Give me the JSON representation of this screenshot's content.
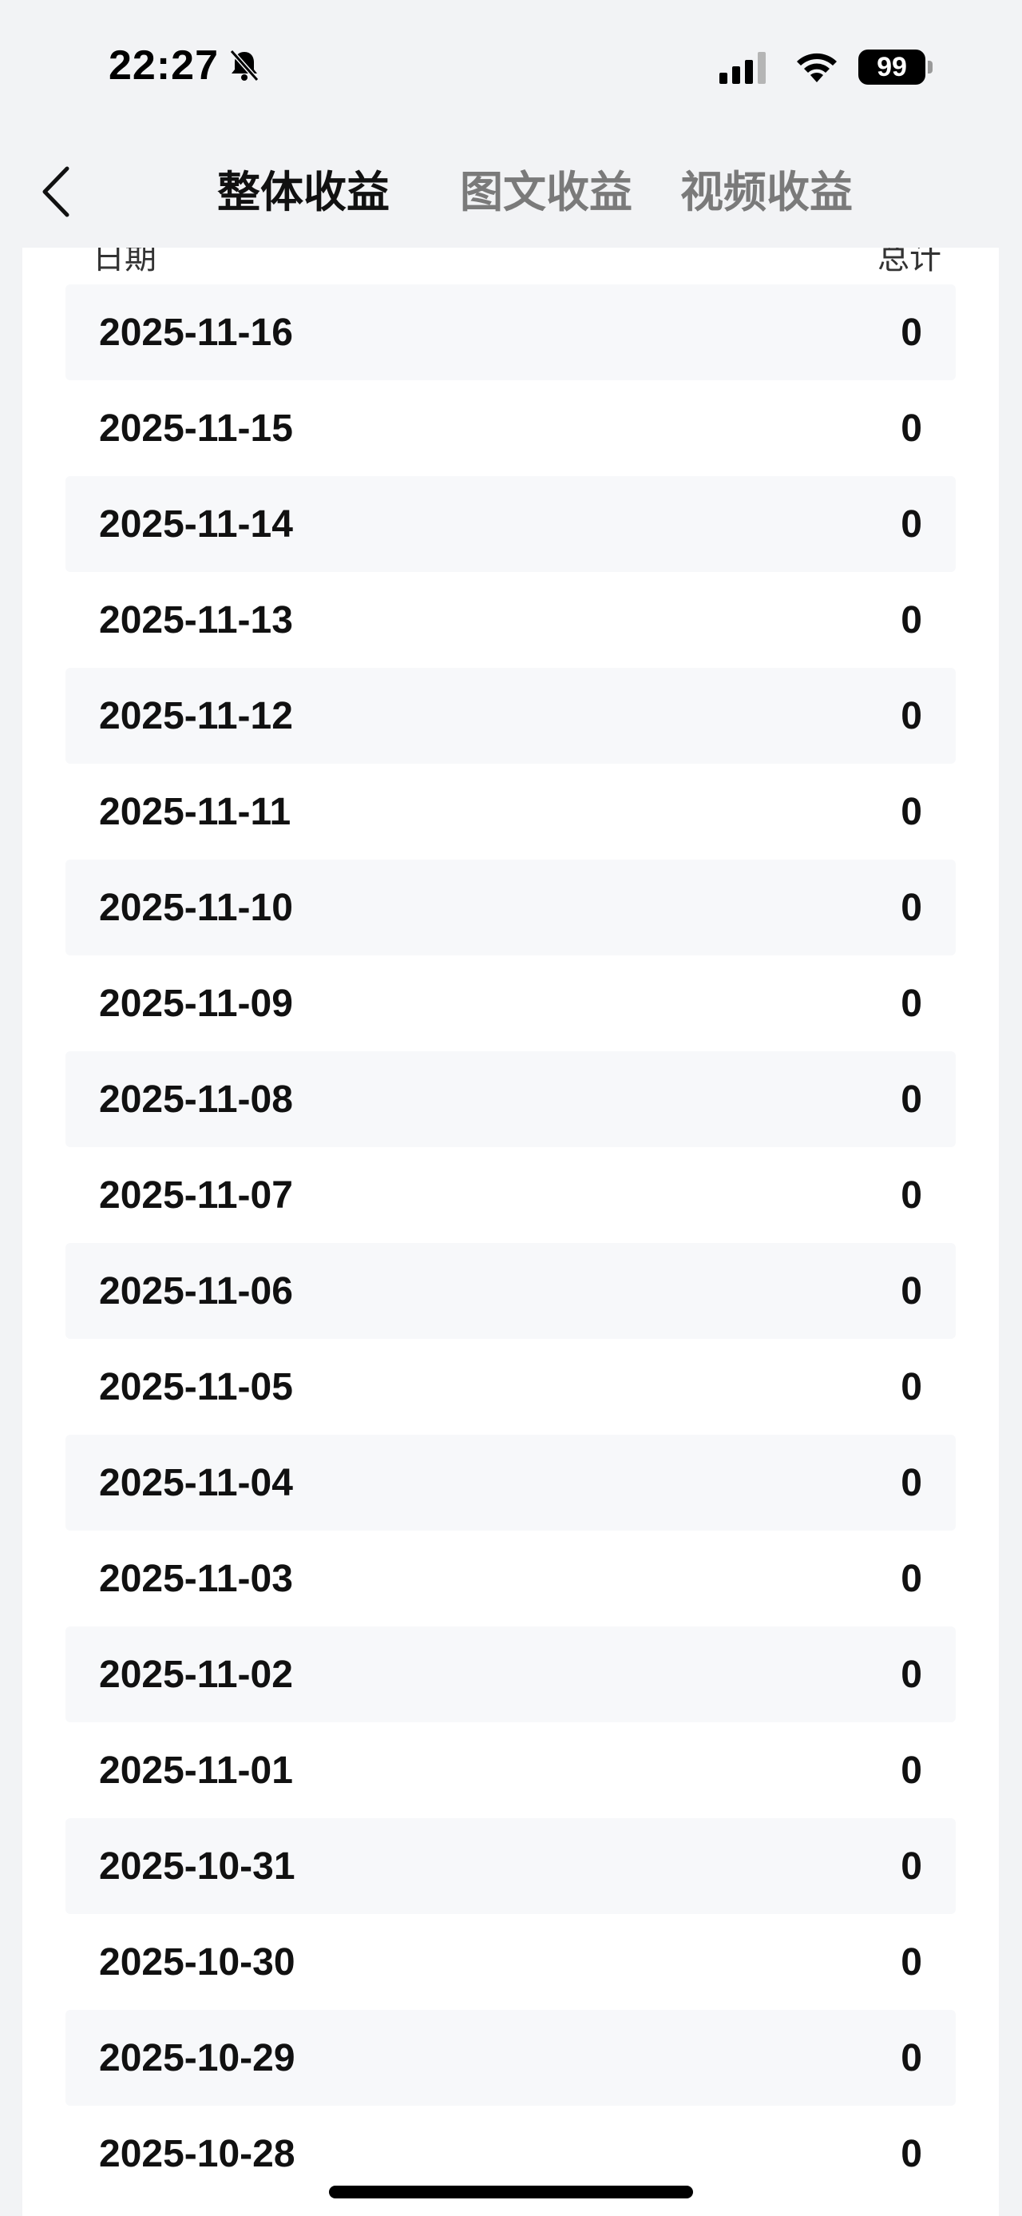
{
  "status_bar": {
    "time": "22:27",
    "battery": "99"
  },
  "nav": {
    "tabs": [
      {
        "label": "整体收益",
        "active": true
      },
      {
        "label": "图文收益",
        "active": false
      },
      {
        "label": "视频收益",
        "active": false
      }
    ]
  },
  "table": {
    "header_date": "日期",
    "header_total": "总计",
    "rows": [
      {
        "date": "2025-11-16",
        "value": "0"
      },
      {
        "date": "2025-11-15",
        "value": "0"
      },
      {
        "date": "2025-11-14",
        "value": "0"
      },
      {
        "date": "2025-11-13",
        "value": "0"
      },
      {
        "date": "2025-11-12",
        "value": "0"
      },
      {
        "date": "2025-11-11",
        "value": "0"
      },
      {
        "date": "2025-11-10",
        "value": "0"
      },
      {
        "date": "2025-11-09",
        "value": "0"
      },
      {
        "date": "2025-11-08",
        "value": "0"
      },
      {
        "date": "2025-11-07",
        "value": "0"
      },
      {
        "date": "2025-11-06",
        "value": "0"
      },
      {
        "date": "2025-11-05",
        "value": "0"
      },
      {
        "date": "2025-11-04",
        "value": "0"
      },
      {
        "date": "2025-11-03",
        "value": "0"
      },
      {
        "date": "2025-11-02",
        "value": "0"
      },
      {
        "date": "2025-11-01",
        "value": "0"
      },
      {
        "date": "2025-10-31",
        "value": "0"
      },
      {
        "date": "2025-10-30",
        "value": "0"
      },
      {
        "date": "2025-10-29",
        "value": "0"
      },
      {
        "date": "2025-10-28",
        "value": "0"
      }
    ]
  },
  "icons": {
    "back": "chevron-left-icon",
    "mute": "bell-slash-icon",
    "signal": "cellular-signal-icon",
    "wifi": "wifi-icon",
    "battery": "battery-icon"
  },
  "colors": {
    "page_bg": "#f2f3f5",
    "card_bg": "#ffffff",
    "row_alt_bg": "#f7f8fa",
    "active_tab": "#111111",
    "inactive_tab": "#7a7a7a"
  }
}
